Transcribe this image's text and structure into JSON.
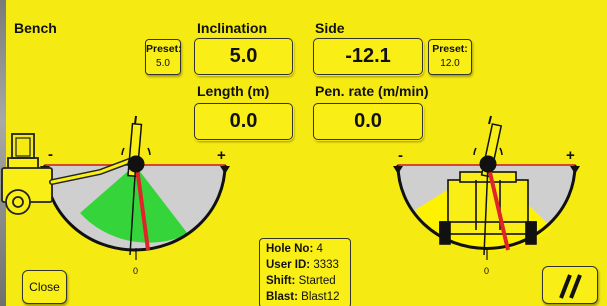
{
  "section_title": "Bench",
  "inclination": {
    "label": "Inclination",
    "value": "5.0",
    "preset_label": "Preset:",
    "preset_value": "5.0"
  },
  "side": {
    "label": "Side",
    "value": "-12.1",
    "preset_label": "Preset:",
    "preset_value": "12.0"
  },
  "length": {
    "label": "Length (m)",
    "value": "0.0"
  },
  "pen_rate": {
    "label": "Pen. rate (m/min)",
    "value": "0.0"
  },
  "left_gauge": {
    "minus": "-",
    "plus": "+",
    "zero": "0"
  },
  "right_gauge": {
    "minus": "-",
    "plus": "+",
    "zero": "0"
  },
  "info": {
    "hole_label": "Hole No:",
    "hole_value": "4",
    "user_label": "User ID:",
    "user_value": "3333",
    "shift_label": "Shift:",
    "shift_value": "Started",
    "blast_label": "Blast:",
    "blast_value": "Blast12"
  },
  "close_button": "Close",
  "menu_button_icon": "double-slash-icon",
  "colors": {
    "panel": "#f5ea12",
    "green_sector": "#35d43a",
    "yellow_sector": "#fff200",
    "red_line": "#e0242a"
  }
}
